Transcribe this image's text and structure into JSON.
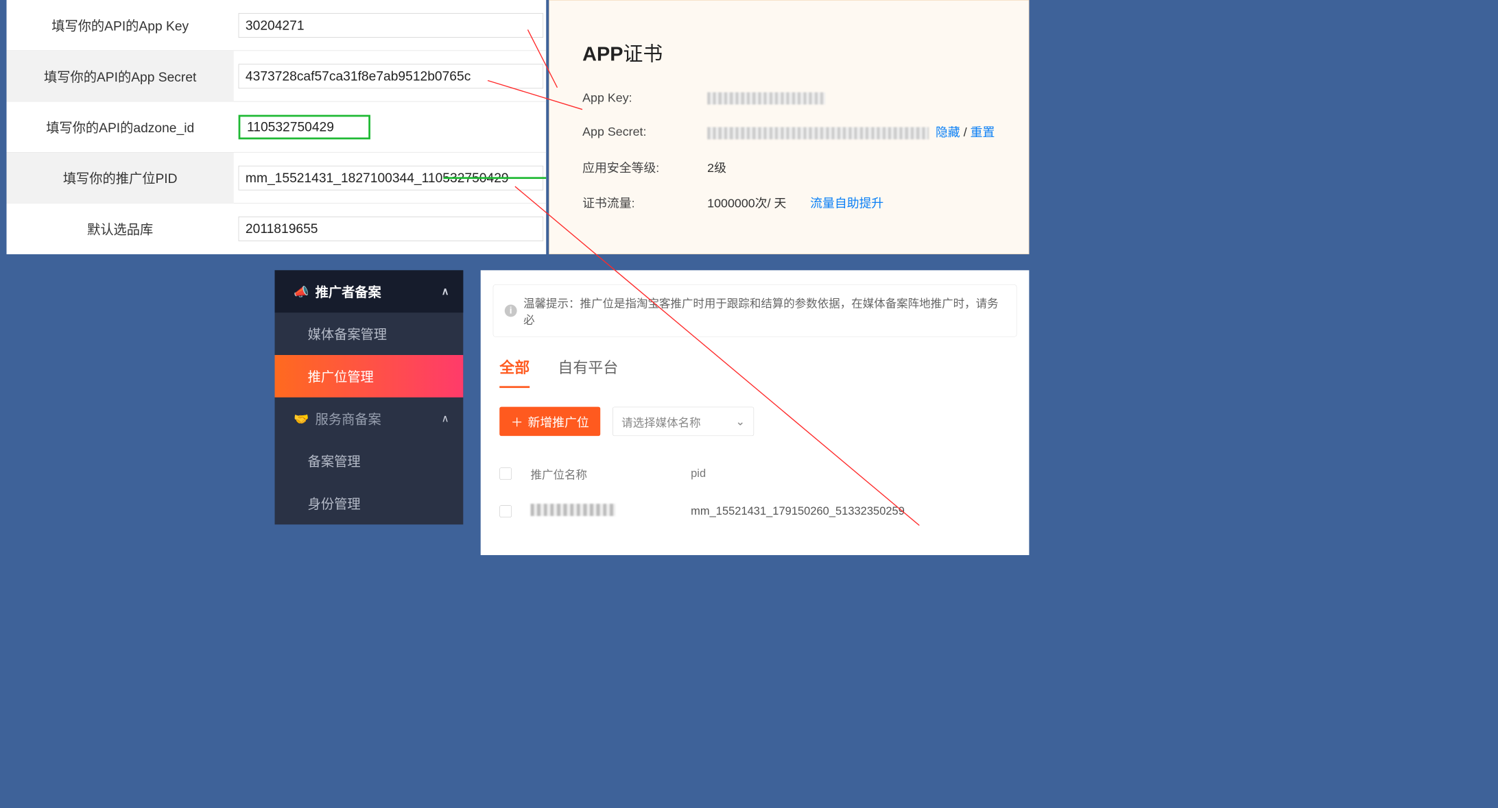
{
  "form": {
    "appKey": {
      "label": "填写你的API的App Key",
      "value": "30204271"
    },
    "appSecret": {
      "label": "填写你的API的App Secret",
      "value": "4373728caf57ca31f8e7ab9512b0765c"
    },
    "adzone": {
      "label": "填写你的API的adzone_id",
      "value": "110532750429"
    },
    "pid": {
      "label": "填写你的推广位PID",
      "value": "mm_15521431_1827100344_110532750429"
    },
    "defaultLib": {
      "label": "默认选品库",
      "value": "2011819655"
    }
  },
  "cert": {
    "titleBold": "APP",
    "titleRest": "证书",
    "appKey": {
      "label": "App Key:"
    },
    "appSecret": {
      "label": "App Secret:",
      "hide": "隐藏",
      "reset": "重置"
    },
    "security": {
      "label": "应用安全等级:",
      "value": "2级"
    },
    "flow": {
      "label": "证书流量:",
      "value": "1000000次/ 天",
      "link": "流量自助提升"
    }
  },
  "sidebar": {
    "group1": {
      "title": "推广者备案",
      "items": [
        "媒体备案管理",
        "推广位管理"
      ]
    },
    "group2": {
      "title": "服务商备案",
      "items": [
        "备案管理",
        "身份管理"
      ]
    }
  },
  "promo": {
    "tip": "温馨提示：推广位是指淘宝客推广时用于跟踪和结算的参数依据，在媒体备案阵地推广时，请务必",
    "tabs": [
      "全部",
      "自有平台"
    ],
    "addBtn": "新增推广位",
    "selectPlaceholder": "请选择媒体名称",
    "columns": [
      "推广位名称",
      "pid"
    ],
    "rows": [
      {
        "pid": "mm_15521431_179150260_51332350259"
      }
    ]
  }
}
